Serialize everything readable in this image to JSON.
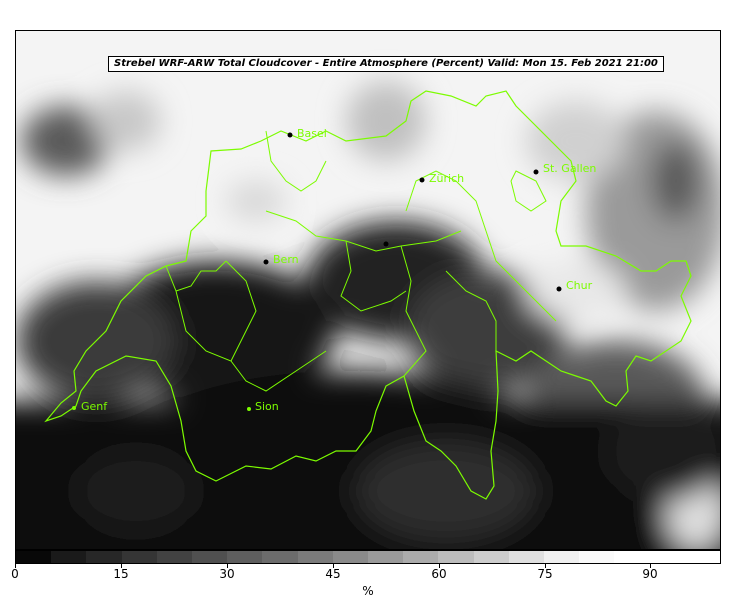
{
  "map": {
    "title": "Strebel WRF-ARW Total Cloudcover - Entire Atmosphere (Percent)   Valid: Mon 15. Feb 2021 21:00",
    "border_color": "#7CFC00",
    "cities": [
      {
        "name": "Basel",
        "icon": "city-dot"
      },
      {
        "name": "Zürich",
        "icon": "city-dot"
      },
      {
        "name": "St. Gallen",
        "icon": "city-dot"
      },
      {
        "name": "Bern",
        "icon": "city-dot"
      },
      {
        "name": "Chur",
        "icon": "city-dot"
      },
      {
        "name": "Genf",
        "icon": "city-dot"
      },
      {
        "name": "Sion",
        "icon": "city-dot"
      },
      {
        "name": "",
        "icon": "city-dot"
      }
    ]
  },
  "colorbar": {
    "unit": "%",
    "range": [
      0,
      100
    ],
    "ticks": [
      "0",
      "15",
      "30",
      "45",
      "60",
      "75",
      "90"
    ],
    "colors": [
      "#080808",
      "#1a1a1a",
      "#272727",
      "#353535",
      "#424242",
      "#505050",
      "#5e5e5e",
      "#6c6c6c",
      "#7b7b7b",
      "#8a8a8a",
      "#9a9a9a",
      "#ababab",
      "#bcbcbc",
      "#cdcdcd",
      "#dfdfdf",
      "#f0f0f0",
      "#fafafa",
      "#ffffff",
      "#ffffff",
      "#ffffff"
    ]
  }
}
